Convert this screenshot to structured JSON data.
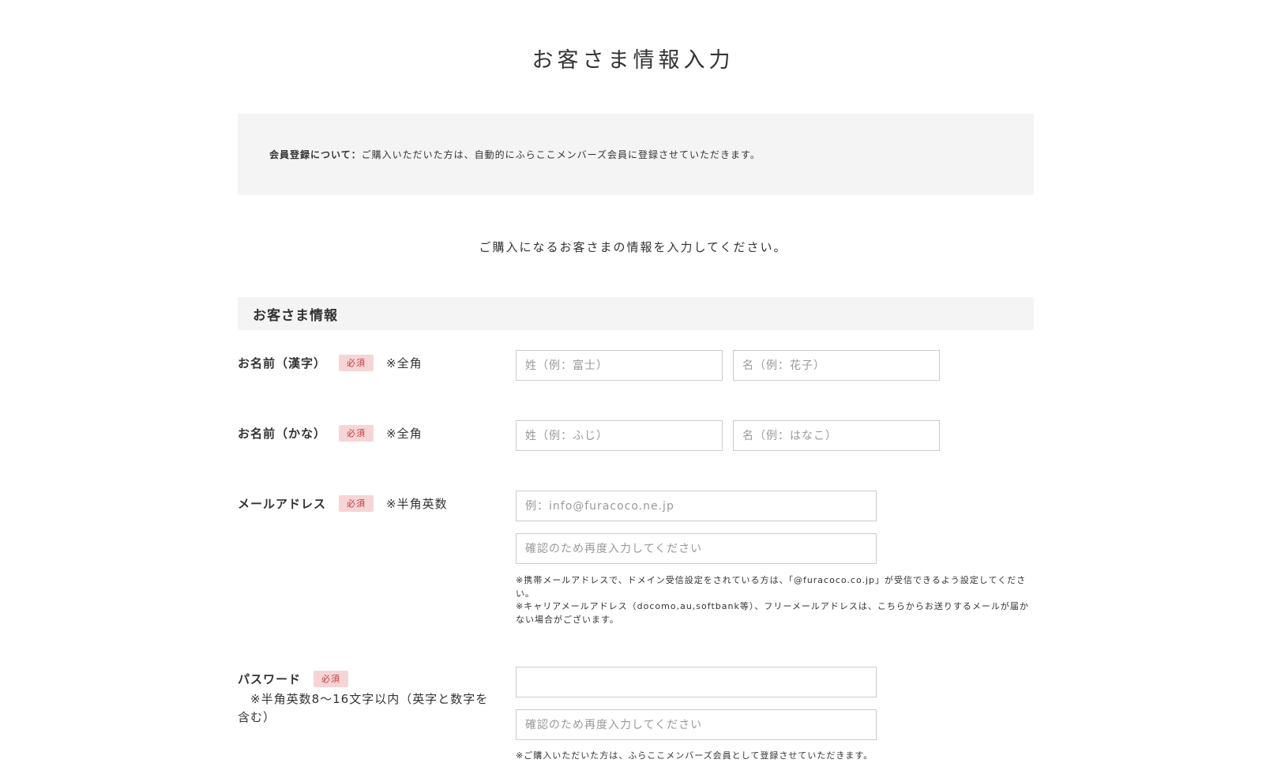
{
  "page_title": "お客さま情報入力",
  "notice": {
    "label": "会員登録について：",
    "text": "ご購入いただいた方は、自動的にふらここメンバーズ会員に登録させていただきます。"
  },
  "intro": "ご購入になるお客さまの情報を入力してください。",
  "section_title": "お客さま情報",
  "required_label": "必須",
  "name_kanji": {
    "label": "お名前（漢字）",
    "note": "※全角",
    "last_placeholder": "姓（例：富士）",
    "first_placeholder": "名（例：花子）"
  },
  "name_kana": {
    "label": "お名前（かな）",
    "note": "※全角",
    "last_placeholder": "姓（例：ふじ）",
    "first_placeholder": "名（例：はなこ）"
  },
  "email": {
    "label": "メールアドレス",
    "note": "※半角英数",
    "placeholder": "例：info@furacoco.ne.jp",
    "confirm_placeholder": "確認のため再度入力してください",
    "help1": "※携帯メールアドレスで、ドメイン受信設定をされている方は、「@furacoco.co.jp」が受信できるよう設定してください。",
    "help2": "※キャリアメールアドレス（docomo,au,softbank等）、フリーメールアドレスは、こちらからお送りするメールが届かない場合がございます。"
  },
  "password": {
    "label": "パスワード",
    "note": "※半角英数8〜16文字以内（英字と数字を含む）",
    "placeholder": "",
    "confirm_placeholder": "確認のため再度入力してください",
    "help": "※ご購入いただいた方は、ふらここメンバーズ会員として登録させていただきます。"
  }
}
